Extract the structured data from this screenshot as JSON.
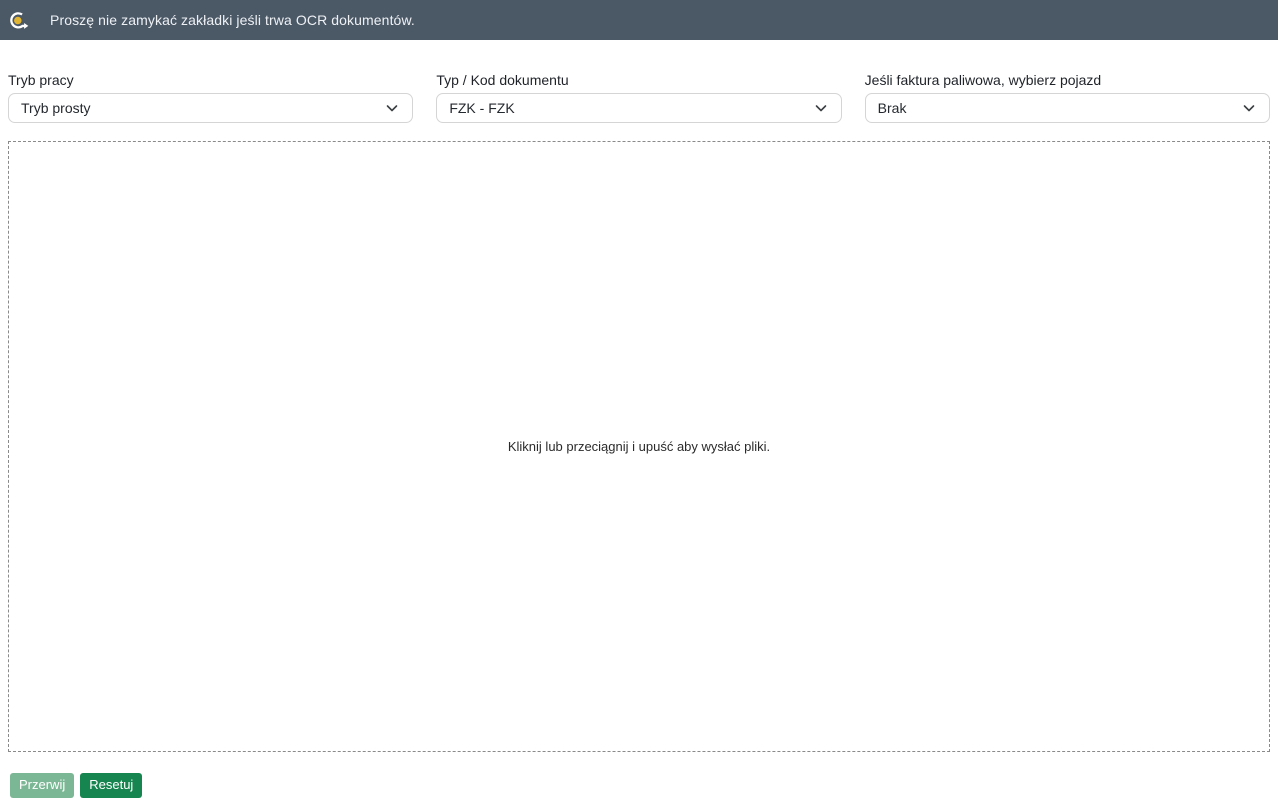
{
  "header": {
    "message": "Proszę nie zamykać zakładki jeśli trwa OCR dokumentów.",
    "icon": "rotate-arrow-with-dot",
    "colors": {
      "background": "#4b5866",
      "text": "#eef1f4",
      "icon_arrow": "#ffffff",
      "icon_dot": "#e2b533"
    }
  },
  "form": {
    "fields": [
      {
        "label": "Tryb pracy",
        "value": "Tryb prosty"
      },
      {
        "label": "Typ / Kod dokumentu",
        "value": "FZK - FZK"
      },
      {
        "label": "Jeśli faktura paliwowa, wybierz pojazd",
        "value": "Brak"
      }
    ]
  },
  "dropzone": {
    "text": "Kliknij lub przeciągnij i upuść aby wysłać pliki."
  },
  "actions": {
    "abort_label": "Przerwij",
    "reset_label": "Resetuj",
    "colors": {
      "abort_background": "#7cb795",
      "reset_background": "#17854f",
      "text": "#ffffff"
    }
  }
}
